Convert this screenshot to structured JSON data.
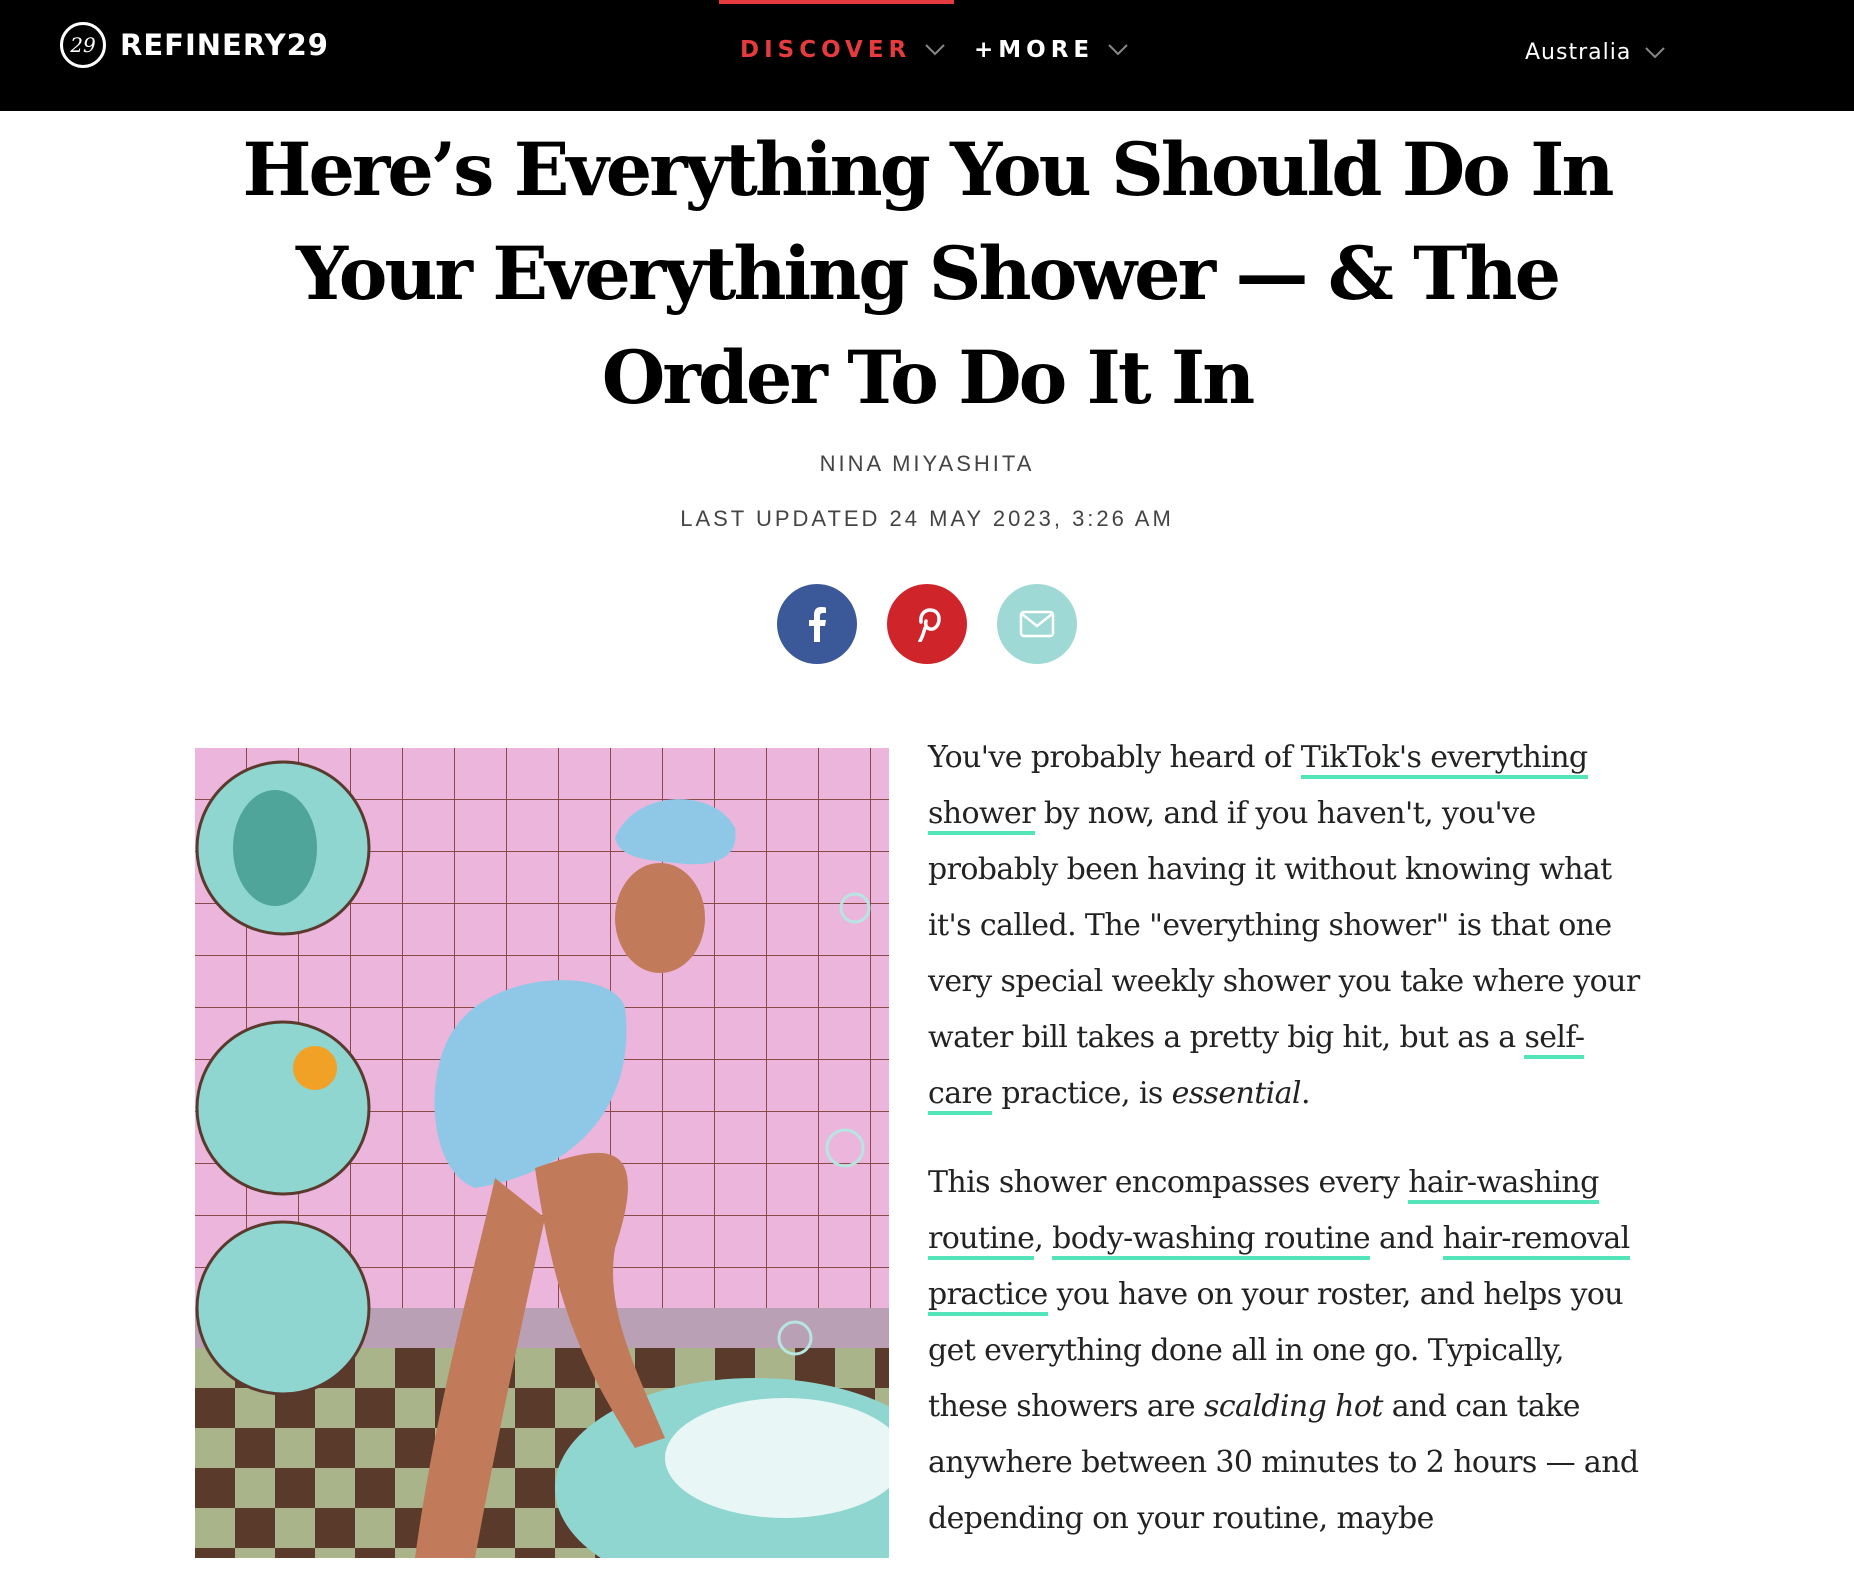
{
  "header": {
    "logo_text": "REFINERY29",
    "logo_mark": "29",
    "nav": [
      {
        "label": "DISCOVER",
        "active": true
      },
      {
        "label": "+MORE",
        "active": false
      }
    ],
    "region": "Australia",
    "accent_color": "#e53b3e"
  },
  "article": {
    "title": "Here’s Everything You Should Do In Your Everything Shower — & The Order To Do It In",
    "author": "NINA MIYASHITA",
    "updated": "LAST UPDATED 24 MAY 2023, 3:26 AM",
    "share": [
      {
        "name": "facebook",
        "icon": "facebook-icon",
        "color": "#3b5998"
      },
      {
        "name": "pinterest",
        "icon": "pinterest-icon",
        "color": "#d0242b"
      },
      {
        "name": "email",
        "icon": "mail-icon",
        "color": "#9fd9d5"
      }
    ],
    "link_underline_color": "#52e5b9",
    "p1": {
      "t1": "You've probably heard of ",
      "link1": "TikTok's everything shower",
      "t2": " by now, and if you haven't, you've probably been having it without knowing what it's called. The \"everything shower\" is that one very special weekly shower you take where your water bill takes a pretty big hit, but as a ",
      "link2": "self-care",
      "t3": " practice, is ",
      "em": "essential",
      "t4": "."
    },
    "p2": {
      "t1": "This shower encompasses every ",
      "link1": "hair-washing routine",
      "t2": ", ",
      "link2": "body-washing routine",
      "t3": " and ",
      "link3": "hair-removal practice",
      "t4": " you have on your roster, and helps you get everything done all in one go. Typically, these showers are ",
      "em": "scalding hot",
      "t5": " and can take anywhere between 30 minutes to 2 hours — and depending on your routine, maybe"
    }
  }
}
